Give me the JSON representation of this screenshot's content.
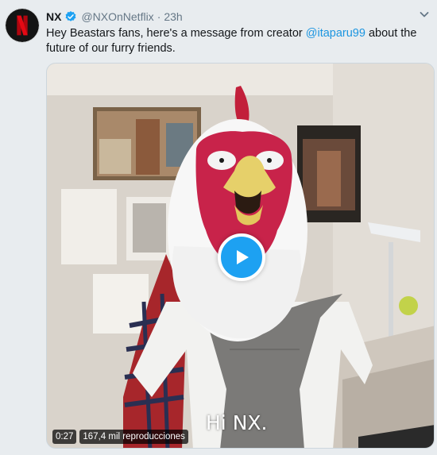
{
  "tweet": {
    "author_name": "NX",
    "author_handle": "@NXOnNetflix",
    "separator": "·",
    "timestamp": "23h",
    "text_before": "Hey Beastars fans, here's a message from creator ",
    "mention": "@itaparu99",
    "text_after": " about the future of our furry friends.",
    "verified": true
  },
  "video": {
    "subtitle": "Hi NX.",
    "duration": "0:27",
    "views": "167,4 mil reproducciones"
  },
  "icons": {
    "avatar": "netflix-n-logo",
    "verified": "verified-badge-icon",
    "menu": "chevron-down-icon",
    "play": "play-icon"
  },
  "colors": {
    "accent": "#1da1f2",
    "link": "#1b95e0",
    "netflix_red": "#e50914",
    "muted": "#657786"
  }
}
